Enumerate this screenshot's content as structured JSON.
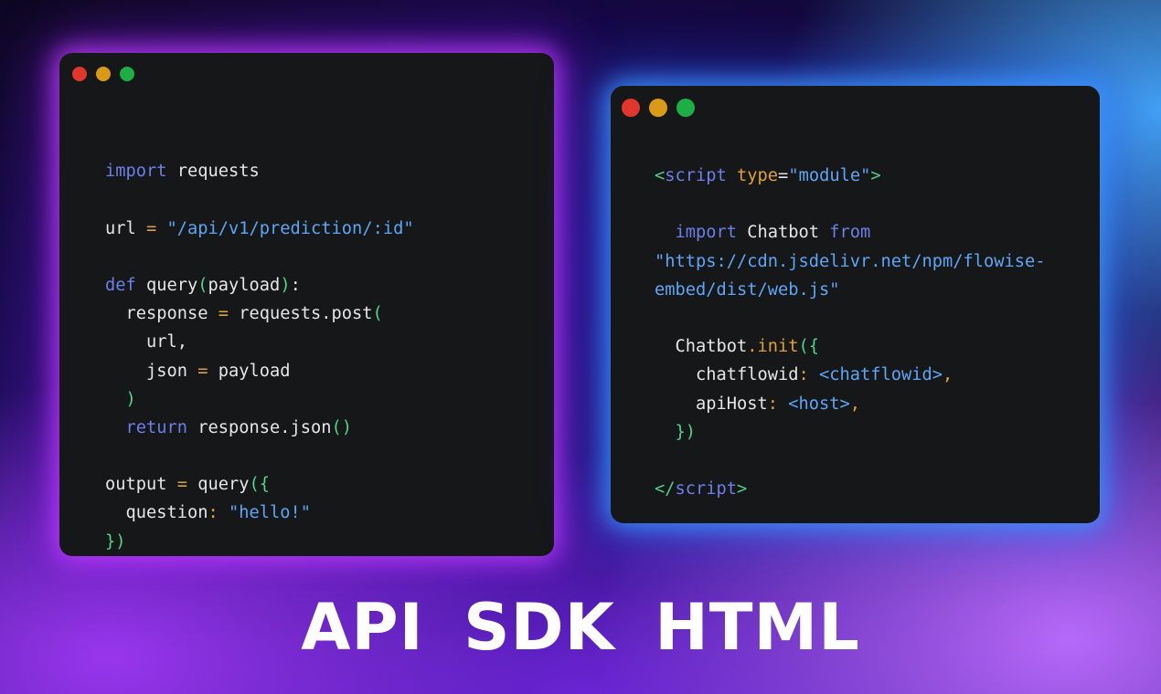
{
  "left_window": {
    "code_lines": [
      [],
      [
        {
          "t": "import",
          "c": "kw"
        },
        {
          "t": " requests",
          "c": ""
        }
      ],
      [],
      [
        {
          "t": "url ",
          "c": ""
        },
        {
          "t": "=",
          "c": "op"
        },
        {
          "t": " ",
          "c": ""
        },
        {
          "t": "\"/api/v1/prediction/:id\"",
          "c": "str"
        }
      ],
      [],
      [
        {
          "t": "def",
          "c": "kw"
        },
        {
          "t": " query",
          "c": ""
        },
        {
          "t": "(",
          "c": "br"
        },
        {
          "t": "payload",
          "c": ""
        },
        {
          "t": ")",
          "c": "br"
        },
        {
          "t": ":",
          "c": ""
        }
      ],
      [
        {
          "t": "  response ",
          "c": ""
        },
        {
          "t": "=",
          "c": "op"
        },
        {
          "t": " requests.post",
          "c": ""
        },
        {
          "t": "(",
          "c": "br"
        }
      ],
      [
        {
          "t": "    url,",
          "c": ""
        }
      ],
      [
        {
          "t": "    json ",
          "c": ""
        },
        {
          "t": "=",
          "c": "op"
        },
        {
          "t": " payload",
          "c": ""
        }
      ],
      [
        {
          "t": "  ",
          "c": ""
        },
        {
          "t": ")",
          "c": "br"
        }
      ],
      [
        {
          "t": "  ",
          "c": ""
        },
        {
          "t": "return",
          "c": "kw"
        },
        {
          "t": " response.json",
          "c": ""
        },
        {
          "t": "()",
          "c": "br"
        }
      ],
      [],
      [
        {
          "t": "output ",
          "c": ""
        },
        {
          "t": "=",
          "c": "op"
        },
        {
          "t": " query",
          "c": ""
        },
        {
          "t": "({",
          "c": "br"
        }
      ],
      [
        {
          "t": "  question",
          "c": ""
        },
        {
          "t": ":",
          "c": "op"
        },
        {
          "t": " ",
          "c": ""
        },
        {
          "t": "\"hello!\"",
          "c": "str"
        }
      ],
      [
        {
          "t": "})",
          "c": "br"
        }
      ]
    ]
  },
  "right_window": {
    "code_lines": [
      [
        {
          "t": "<",
          "c": "tag"
        },
        {
          "t": "script",
          "c": "tagname"
        },
        {
          "t": " type",
          "c": "attr"
        },
        {
          "t": "=",
          "c": ""
        },
        {
          "t": "\"module\"",
          "c": "str"
        },
        {
          "t": ">",
          "c": "tag"
        }
      ],
      [],
      [
        {
          "t": "  ",
          "c": ""
        },
        {
          "t": "import",
          "c": "kw"
        },
        {
          "t": " Chatbot ",
          "c": ""
        },
        {
          "t": "from",
          "c": "kw"
        }
      ],
      [
        {
          "t": "\"https://cdn.jsdelivr.net/npm/flowise-",
          "c": "str"
        }
      ],
      [
        {
          "t": "embed/dist/web.js\"",
          "c": "str"
        }
      ],
      [],
      [
        {
          "t": "  Chatbot",
          "c": ""
        },
        {
          "t": ".init",
          "c": "op"
        },
        {
          "t": "({",
          "c": "br"
        }
      ],
      [
        {
          "t": "    chatflowid",
          "c": ""
        },
        {
          "t": ":",
          "c": "op"
        },
        {
          "t": " <chatflowid>",
          "c": "ph"
        },
        {
          "t": ",",
          "c": "op"
        }
      ],
      [
        {
          "t": "    apiHost",
          "c": ""
        },
        {
          "t": ":",
          "c": "op"
        },
        {
          "t": " <host>",
          "c": "ph"
        },
        {
          "t": ",",
          "c": "op"
        }
      ],
      [
        {
          "t": "  })",
          "c": "br"
        }
      ],
      [],
      [
        {
          "t": "</",
          "c": "tag"
        },
        {
          "t": "script",
          "c": "tagname"
        },
        {
          "t": ">",
          "c": "tag"
        }
      ]
    ]
  },
  "title": "API SDK HTML",
  "colors": {
    "keyword": "#6d7fe8",
    "operator": "#e0a13b",
    "string": "#5ea6f5",
    "bracket": "#52d48a",
    "window_bg": "#161719",
    "dot_red": "#e0362b",
    "dot_yellow": "#d99a17",
    "dot_green": "#1fae45"
  }
}
